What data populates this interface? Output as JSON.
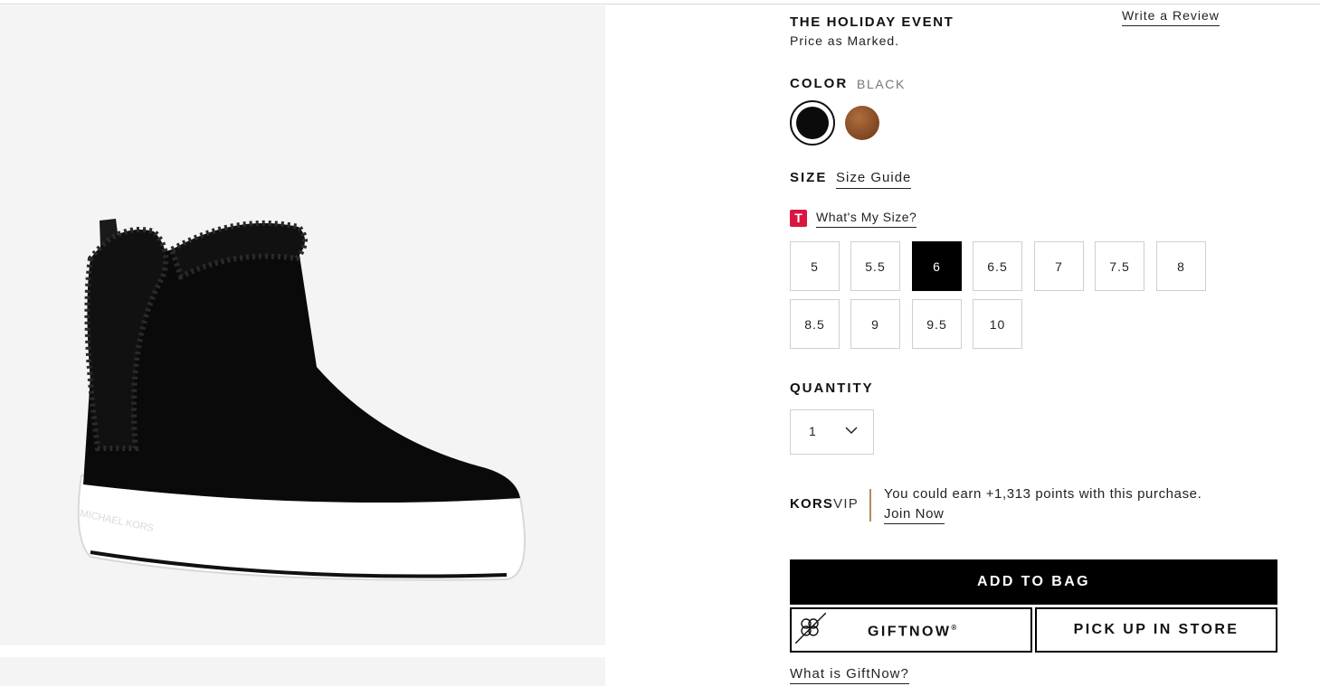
{
  "promo": {
    "title": "THE HOLIDAY EVENT",
    "subtitle": "Price as Marked."
  },
  "review": {
    "label": "Write a Review"
  },
  "color": {
    "label": "COLOR",
    "selected": "BLACK",
    "swatches": [
      {
        "name": "black",
        "color": "#0b0b0b",
        "selected": true
      },
      {
        "name": "brown",
        "color": "#8b4f2a",
        "selected": false
      }
    ]
  },
  "size": {
    "label": "SIZE",
    "guide_label": "Size Guide",
    "fit_badge": "T",
    "fit_label": "What's My Size?",
    "options": [
      "5",
      "5.5",
      "6",
      "6.5",
      "7",
      "7.5",
      "8",
      "8.5",
      "9",
      "9.5",
      "10"
    ],
    "selected": "6"
  },
  "quantity": {
    "label": "QUANTITY",
    "value": "1"
  },
  "loyalty": {
    "brand_bold": "KORS",
    "brand_light": "VIP",
    "earn_text": "You could earn +1,313 points with this purchase.",
    "join_label": "Join Now"
  },
  "actions": {
    "add_to_bag": "ADD TO BAG",
    "giftnow": "GIFTNOW",
    "giftnow_mark": "®",
    "pickup": "PICK UP IN STORE",
    "what_giftnow": "What is GiftNow?"
  },
  "product_image": {
    "icon": "slip-on-sneaker-image",
    "imprint": "MICHAEL KORS"
  }
}
